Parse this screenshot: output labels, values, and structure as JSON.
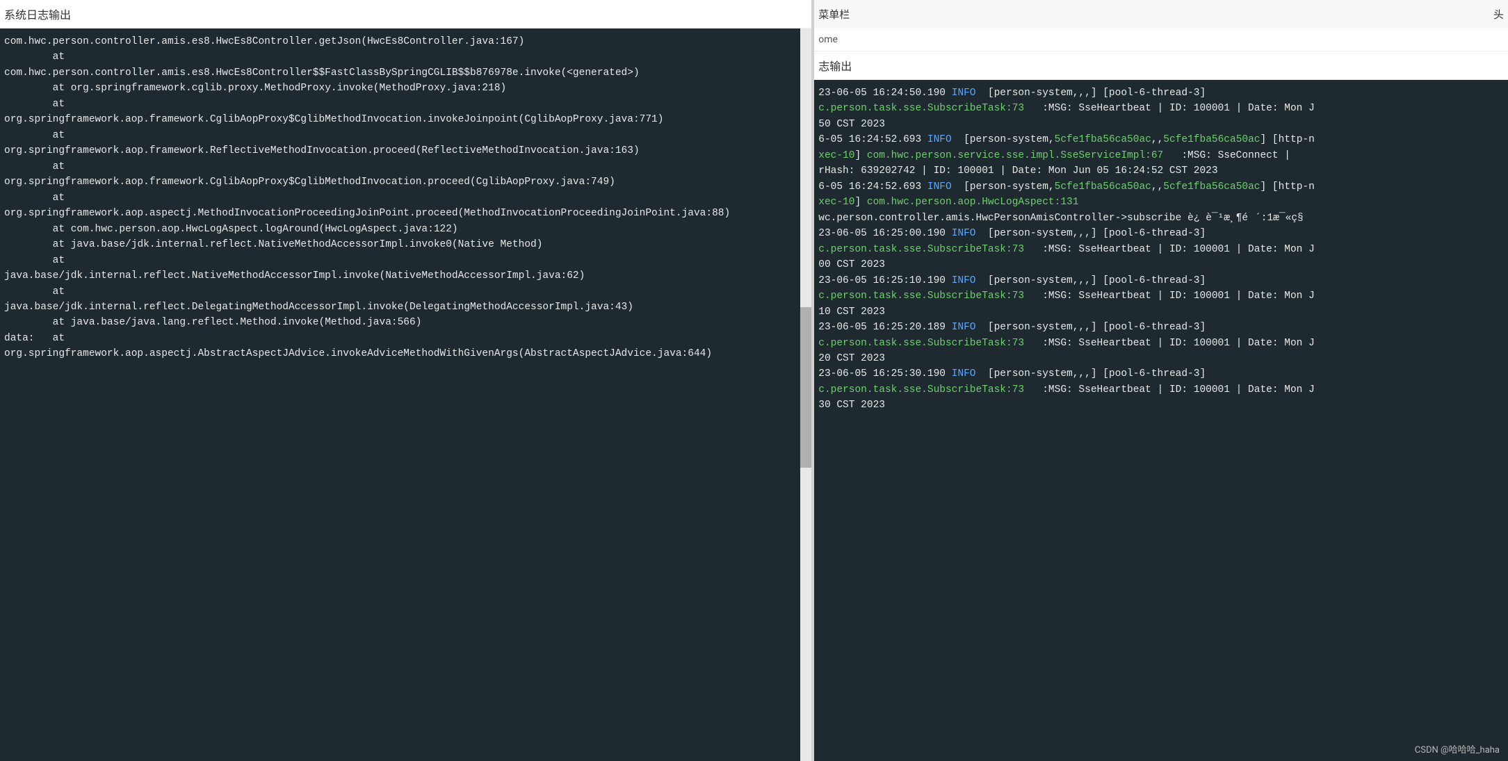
{
  "left": {
    "title": "系统日志输出",
    "lines": [
      "com.hwc.person.controller.amis.es8.HwcEs8Controller.getJson(HwcEs8Controller.java:167)",
      "        at",
      "com.hwc.person.controller.amis.es8.HwcEs8Controller$$FastClassBySpringCGLIB$$b876978e.invoke(<generated>)",
      "        at org.springframework.cglib.proxy.MethodProxy.invoke(MethodProxy.java:218)",
      "        at",
      "org.springframework.aop.framework.CglibAopProxy$CglibMethodInvocation.invokeJoinpoint(CglibAopProxy.java:771)",
      "        at",
      "org.springframework.aop.framework.ReflectiveMethodInvocation.proceed(ReflectiveMethodInvocation.java:163)",
      "        at",
      "org.springframework.aop.framework.CglibAopProxy$CglibMethodInvocation.proceed(CglibAopProxy.java:749)",
      "        at",
      "org.springframework.aop.aspectj.MethodInvocationProceedingJoinPoint.proceed(MethodInvocationProceedingJoinPoint.java:88)",
      "        at com.hwc.person.aop.HwcLogAspect.logAround(HwcLogAspect.java:122)",
      "        at java.base/jdk.internal.reflect.NativeMethodAccessorImpl.invoke0(Native Method)",
      "        at",
      "java.base/jdk.internal.reflect.NativeMethodAccessorImpl.invoke(NativeMethodAccessorImpl.java:62)",
      "        at",
      "java.base/jdk.internal.reflect.DelegatingMethodAccessorImpl.invoke(DelegatingMethodAccessorImpl.java:43)",
      "        at java.base/java.lang.reflect.Method.invoke(Method.java:566)",
      "data:   at",
      "org.springframework.aop.aspectj.AbstractAspectJAdvice.invokeAdviceMethodWithGivenArgs(AbstractAspectJAdvice.java:644)"
    ]
  },
  "right": {
    "menubar": "菜单栏",
    "menubar_right": "头",
    "subnav": "ome",
    "title": "志输出",
    "entries": [
      {
        "ts": "23-06-05 16:24:50.190",
        "level": "INFO",
        "ctx": " [person-system,,,] [pool-6-thread-3]",
        "src": "c.person.task.sse.SubscribeTask:73",
        "msg": "   :MSG: SseHeartbeat | ID: 100001 | Date: Mon J",
        "tail": "50 CST 2023"
      },
      {
        "ts": "6-05 16:24:52.693",
        "level": "INFO",
        "ctx_pre": " [person-system,",
        "trace1": "5cfe1fba56ca50ac",
        "comma": ",,",
        "trace2": "5cfe1fba56ca50ac",
        "ctx_post": "] [http-n",
        "xec": "xec-10",
        "xec_post": "] ",
        "src": "com.hwc.person.service.sse.impl.SseServiceImpl:67",
        "msg": "   :MSG: SseConnect |",
        "tail": "rHash: 639202742 | ID: 100001 | Date: Mon Jun 05 16:24:52 CST 2023"
      },
      {
        "ts": "6-05 16:24:52.693",
        "level": "INFO",
        "ctx_pre": " [person-system,",
        "trace1": "5cfe1fba56ca50ac",
        "comma": ",,",
        "trace2": "5cfe1fba56ca50ac",
        "ctx_post": "] [http-n",
        "xec": "xec-10",
        "xec_post": "] ",
        "src": "com.hwc.person.aop.HwcLogAspect:131",
        "msg": "",
        "tail": "wc.person.controller.amis.HwcPersonAmisController->subscribe è¿è¯¹æ¸¶é´:1æ¯«ç§"
      },
      {
        "ts": "23-06-05 16:25:00.190",
        "level": "INFO",
        "ctx": " [person-system,,,] [pool-6-thread-3]",
        "src": "c.person.task.sse.SubscribeTask:73",
        "msg": "   :MSG: SseHeartbeat | ID: 100001 | Date: Mon J",
        "tail": "00 CST 2023"
      },
      {
        "ts": "23-06-05 16:25:10.190",
        "level": "INFO",
        "ctx": " [person-system,,,] [pool-6-thread-3]",
        "src": "c.person.task.sse.SubscribeTask:73",
        "msg": "   :MSG: SseHeartbeat | ID: 100001 | Date: Mon J",
        "tail": "10 CST 2023"
      },
      {
        "ts": "23-06-05 16:25:20.189",
        "level": "INFO",
        "ctx": " [person-system,,,] [pool-6-thread-3]",
        "src": "c.person.task.sse.SubscribeTask:73",
        "msg": "   :MSG: SseHeartbeat | ID: 100001 | Date: Mon J",
        "tail": "20 CST 2023"
      },
      {
        "ts": "23-06-05 16:25:30.190",
        "level": "INFO",
        "ctx": " [person-system,,,] [pool-6-thread-3]",
        "src": "c.person.task.sse.SubscribeTask:73",
        "msg": "   :MSG: SseHeartbeat | ID: 100001 | Date: Mon J",
        "tail": "30 CST 2023"
      }
    ]
  },
  "watermark": "CSDN @哈哈哈_haha"
}
